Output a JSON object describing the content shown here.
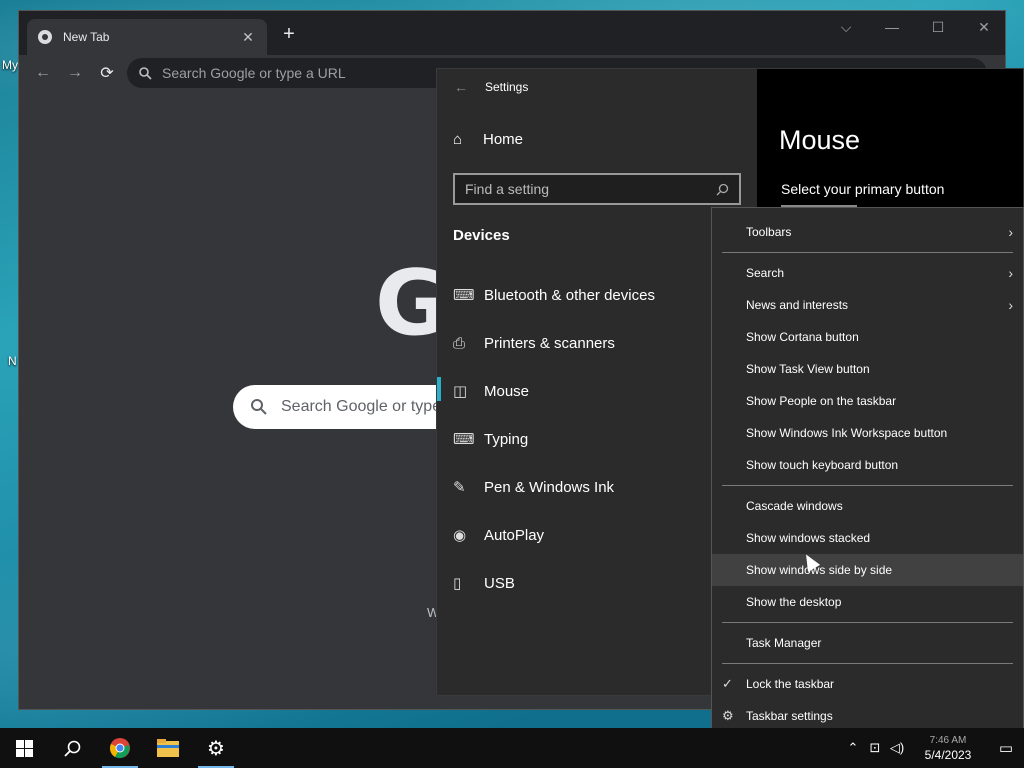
{
  "desktop": {
    "labels": [
      "My",
      "N"
    ]
  },
  "chrome": {
    "tab_title": "New Tab",
    "tab_close": "✕",
    "new_tab": "+",
    "controls": {
      "dropdown": "⌵",
      "minimize": "—",
      "maximize": "☐",
      "close": "✕"
    },
    "toolbar": {
      "back": "←",
      "forward": "→",
      "reload": "⟳"
    },
    "omnibox_placeholder": "Search Google or type a URL",
    "google_logo": "G",
    "search_placeholder": "Search Google or type",
    "tile_letter": "W"
  },
  "settings": {
    "window_title": "Settings",
    "home_label": "Home",
    "find_placeholder": "Find a setting",
    "section": "Devices",
    "nav": [
      {
        "label": "Bluetooth & other devices",
        "icon": "⌨"
      },
      {
        "label": "Printers & scanners",
        "icon": "⎙"
      },
      {
        "label": "Mouse",
        "icon": "◫"
      },
      {
        "label": "Typing",
        "icon": "⌨"
      },
      {
        "label": "Pen & Windows Ink",
        "icon": "✎"
      },
      {
        "label": "AutoPlay",
        "icon": "◉"
      },
      {
        "label": "USB",
        "icon": "▯"
      }
    ],
    "page_title": "Mouse",
    "subheading": "Select your primary button"
  },
  "context_menu": {
    "items": {
      "toolbars": "Toolbars",
      "search": "Search",
      "news": "News and interests",
      "cortana": "Show Cortana button",
      "taskview": "Show Task View button",
      "people": "Show People on the taskbar",
      "ink": "Show Windows Ink Workspace button",
      "touch_keyboard": "Show touch keyboard button",
      "cascade": "Cascade windows",
      "stacked": "Show windows stacked",
      "side_by_side": "Show windows side by side",
      "desktop": "Show the desktop",
      "task_manager": "Task Manager",
      "lock": "Lock the taskbar",
      "taskbar_settings": "Taskbar settings"
    },
    "chevron": "›",
    "check": "✓",
    "gear": "⚙"
  },
  "taskbar": {
    "date": "5/4/2023",
    "time": "7:46 AM"
  }
}
